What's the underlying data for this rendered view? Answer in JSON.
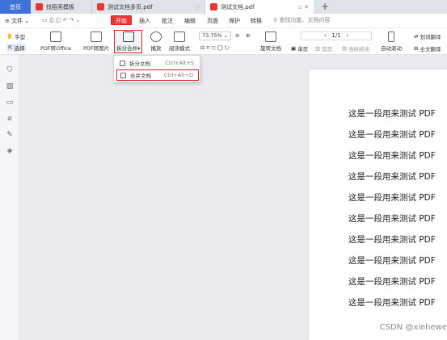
{
  "tabs": [
    {
      "label": "首页"
    },
    {
      "label": "找稻壳模板"
    },
    {
      "label": "测试文档多页.pdf"
    },
    {
      "label": "测试文档.pdf"
    }
  ],
  "new_tab_symbol": "+",
  "menu": {
    "file": "文件",
    "start": "开始",
    "insert": "插入",
    "annotate": "批注",
    "edit": "编辑",
    "page": "页面",
    "protect": "保护",
    "convert": "转换",
    "search_placeholder": "查找功能、文档内容"
  },
  "toolbar": {
    "hand": "手型",
    "select": "选择",
    "pdf_to_office": "PDF转Office",
    "pdf_to_image": "PDF转图片",
    "split_merge": "拆分合并",
    "play": "播放",
    "read_mode": "阅读模式",
    "zoom": "73.75%",
    "page_indicator": "1/1",
    "rotate": "旋转文档",
    "single_page": "单页",
    "double_page": "双页",
    "continuous": "连续阅读",
    "auto_scroll": "自动滚动",
    "word_translate": "划词翻译",
    "full_translate": "全文翻译"
  },
  "dropdown": {
    "items": [
      {
        "label": "拆分文档",
        "shortcut": "Ctrl+Alt+S"
      },
      {
        "label": "合并文档",
        "shortcut": "Ctrl+Alt+D"
      }
    ]
  },
  "document": {
    "lines": [
      "这是一段用来测试 PDF",
      "这是一段用来测试 PDF",
      "这是一段用来测试 PDF",
      "这是一段用来测试 PDF",
      "这是一段用来测试 PDF",
      "这是一段用来测试 PDF",
      "这是一段用来测试 PDF",
      "这是一段用来测试 PDF",
      "这是一段用来测试 PDF",
      "这是一段用来测试 PDF"
    ]
  },
  "watermark": "CSDN @xiehewe",
  "colors": {
    "accent_red": "#e53935",
    "home_tab": "#3f72d8"
  }
}
